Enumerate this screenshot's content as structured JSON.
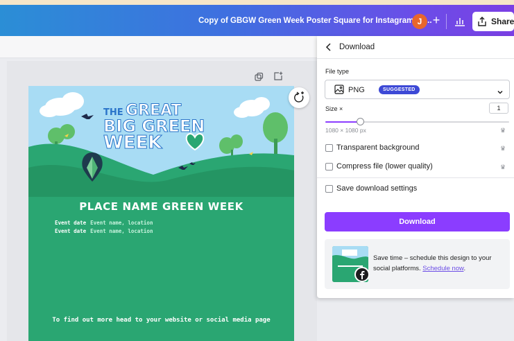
{
  "topbar": {
    "doc_title": "Copy of GBGW Green Week Poster Square for Instagram - 1...",
    "avatar_initial": "J",
    "add_label": "+",
    "share_label": "Share"
  },
  "poster": {
    "logo_line1": "THE GREAT",
    "logo_line2": "BIG GREEN",
    "logo_line3": "WEEK",
    "place_name": "PLACE NAME GREEN WEEK",
    "events": [
      {
        "label": "Event date",
        "value": "Event name, location"
      },
      {
        "label": "Event date",
        "value": "Event name, location"
      }
    ],
    "footer": "To find out more head to your website or social media page"
  },
  "panel": {
    "title": "Download",
    "file_type_label": "File type",
    "file_type_value": "PNG",
    "suggested_badge": "SUGGESTED",
    "size_label": "Size ×",
    "size_value": "1",
    "size_fraction": 0.19,
    "dimensions": "1080 × 1080 px",
    "transparent_label": "Transparent background",
    "compress_label": "Compress file (lower quality)",
    "save_settings_label": "Save download settings",
    "download_label": "Download",
    "promo_text": "Save time – schedule this design to your social platforms.",
    "promo_link": "Schedule now",
    "promo_tail": "."
  },
  "colors": {
    "accent": "#8b3dff",
    "badge": "#3d49d6",
    "poster_green": "#2aa672"
  }
}
